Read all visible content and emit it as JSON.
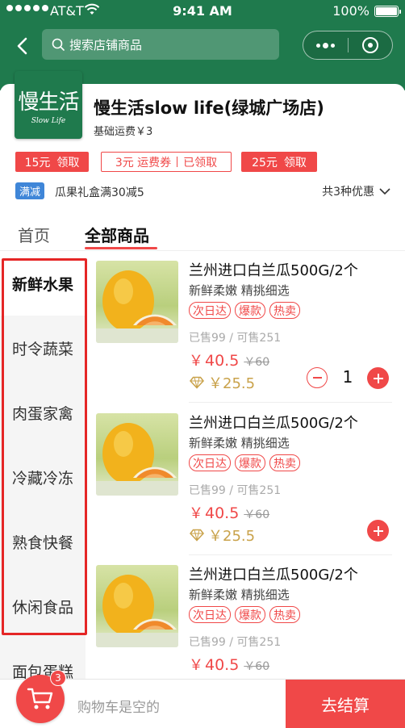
{
  "status_bar": {
    "carrier": "AT&T",
    "time": "9:41 AM",
    "battery": "100%",
    "icons": [
      "signal-dots-icon",
      "wifi-icon",
      "battery-icon"
    ]
  },
  "nav": {
    "back_icon": "chevron-left-icon",
    "search_placeholder": "搜索店铺商品",
    "search_icon": "search-icon",
    "more_icon": "more-dots-icon",
    "close_icon": "target-ring-icon"
  },
  "store": {
    "logo_text": "慢生活",
    "logo_subtext": "Slow Life",
    "name": "慢生活slow life(绿城广场店)",
    "delivery_fee": "基础运费￥3",
    "coupons": [
      {
        "amount": "15元",
        "action": "领取",
        "style": "solid"
      },
      {
        "amount": "3元 运费券",
        "action": "已领取",
        "style": "outline"
      },
      {
        "amount": "25元",
        "action": "领取",
        "style": "solid"
      }
    ],
    "promo_tag": "满减",
    "promo_text": "瓜果礼盒满30减5",
    "promo_more": "共3种优惠"
  },
  "tabs": [
    {
      "label": "首页",
      "active": false
    },
    {
      "label": "全部商品",
      "active": true
    }
  ],
  "categories": [
    {
      "label": "新鲜水果",
      "active": true
    },
    {
      "label": "时令蔬菜",
      "active": false
    },
    {
      "label": "肉蛋家禽",
      "active": false
    },
    {
      "label": "冷藏冷冻",
      "active": false
    },
    {
      "label": "熟食快餐",
      "active": false
    },
    {
      "label": "休闲食品",
      "active": false
    },
    {
      "label": "面包蛋糕",
      "active": false
    }
  ],
  "products": [
    {
      "name": "兰州进口白兰瓜500G/2个",
      "desc": "新鲜柔嫩  精挑细选",
      "badges": [
        "次日达",
        "爆款",
        "热卖"
      ],
      "sold": "已售99 / 可售251",
      "currency": "￥",
      "price": "40.5",
      "orig_price": "￥60",
      "vip_price": "￥25.5",
      "qty": "1"
    },
    {
      "name": "兰州进口白兰瓜500G/2个",
      "desc": "新鲜柔嫩  精挑细选",
      "badges": [
        "次日达",
        "爆款",
        "热卖"
      ],
      "sold": "已售99 / 可售251",
      "currency": "￥",
      "price": "40.5",
      "orig_price": "￥60",
      "vip_price": "￥25.5"
    },
    {
      "name": "兰州进口白兰瓜500G/2个",
      "desc": "新鲜柔嫩  精挑细选",
      "badges": [
        "次日达",
        "爆款",
        "热卖"
      ],
      "sold": "已售99 / 可售251",
      "currency": "￥",
      "price": "40.5",
      "orig_price": "￥60"
    }
  ],
  "cart": {
    "count": "3",
    "empty_text": "购物车是空的",
    "checkout_label": "去结算",
    "icon": "shopping-cart-icon"
  },
  "colors": {
    "brand_green": "#1f7a4d",
    "accent_red": "#f04848",
    "promo_blue": "#3f86d8",
    "vip_gold": "#c9a24a"
  }
}
